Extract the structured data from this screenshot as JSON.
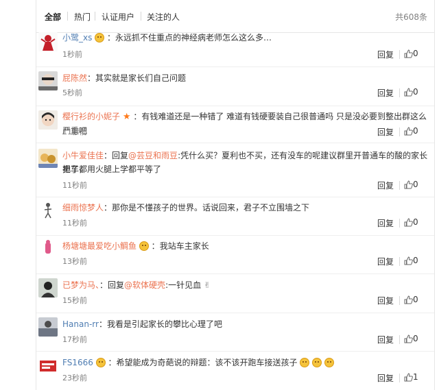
{
  "tabs": [
    "全部",
    "热门",
    "认证用户",
    "关注的人"
  ],
  "total": "共608条",
  "reply_label": "回复",
  "comments": [
    {
      "user": "小鹭_xs",
      "sep": "：",
      "text": "永远抓不住重点的神经病老师怎么这么多…",
      "time": "1秒前",
      "likes": "0"
    },
    {
      "user": "屁陈然",
      "sep": "：",
      "text": "其实就是家长们自己问题",
      "time": "5秒前",
      "likes": "0"
    },
    {
      "user": "樱行衫的小妮子",
      "sep": "：",
      "text": "有钱难道还是一种错了 难道有钱硬要装自己很普通吗 只是没必要到整出群这么严重吧",
      "time": "11秒前",
      "likes": "0"
    },
    {
      "user": "小牛爱佳佳",
      "sep": "：",
      "prefix": "回复",
      "mention": "@芸豆和雨豆",
      "text": ":凭什么买？夏利也不买，还有没车的呢建议群里开普通车的酸的家长把车都",
      "text2": "卖了，用火腿上学都平等了",
      "time": "11秒前",
      "likes": "0"
    },
    {
      "user": "细雨惊梦人",
      "sep": "：",
      "text": "那你是不懂孩子的世界。话说回来，君子不立围墙之下",
      "time": "11秒前",
      "likes": "0"
    },
    {
      "user": "杨塘塘最爱吃小鲷鱼",
      "sep": "：",
      "text": "我站车主家长",
      "time": "13秒前",
      "likes": "0"
    },
    {
      "user": "已梦为马、",
      "sep": "：",
      "prefix": "回复",
      "mention": "@软体硬壳",
      "text": ":一针见血",
      "time": "15秒前",
      "likes": "0"
    },
    {
      "user": "Hanan-rr",
      "sep": "：",
      "text": "我看是引起家长的攀比心理了吧",
      "time": "17秒前",
      "likes": "0"
    },
    {
      "user": "FS1666",
      "sep": "：",
      "text": "希望能成为奇葩说的辩题：该不该开跑车接送孩子",
      "time": "23秒前",
      "likes": "1"
    }
  ]
}
